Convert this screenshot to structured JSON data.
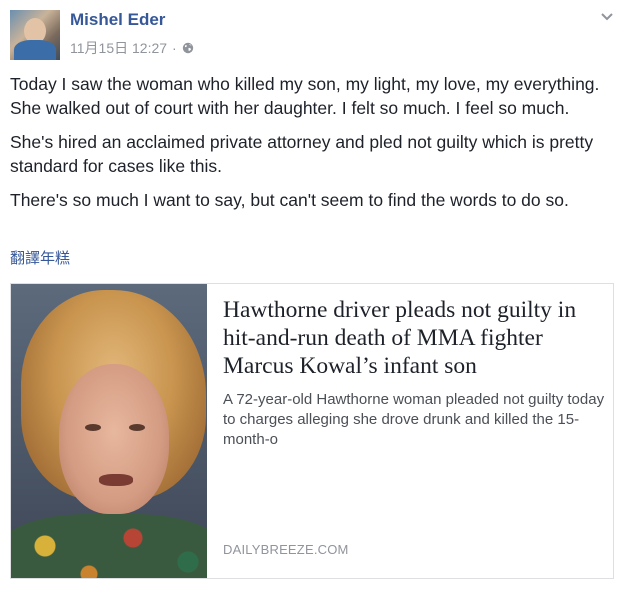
{
  "post": {
    "author": "Mishel Eder",
    "timestamp": "11月15日 12:27",
    "separator": "·",
    "privacy_icon": "globe-icon",
    "menu_icon": "chevron-down-icon",
    "paragraphs": [
      "Today I saw the woman who killed my son, my light, my love, my everything. She walked out of court with her daughter. I felt so much. I feel so much.",
      "She's hired an acclaimed private attorney and pled not guilty which is pretty standard for cases like this.",
      "There's so much I want to say, but can't seem to find the words to do so."
    ],
    "translate_link": "翻譯年糕"
  },
  "link_card": {
    "headline": "Hawthorne driver pleads not guilty in hit-and-run death of MMA fighter Marcus Kowal’s infant son",
    "summary": "A 72-year-old Hawthorne woman pleaded not guilty today to charges alleging she drove drunk and killed the 15-month-o",
    "domain": "DAILYBREEZE.COM"
  },
  "colors": {
    "link_blue": "#365899",
    "meta_gray": "#90949c",
    "text": "#1d2129",
    "border": "#dddfe2"
  }
}
